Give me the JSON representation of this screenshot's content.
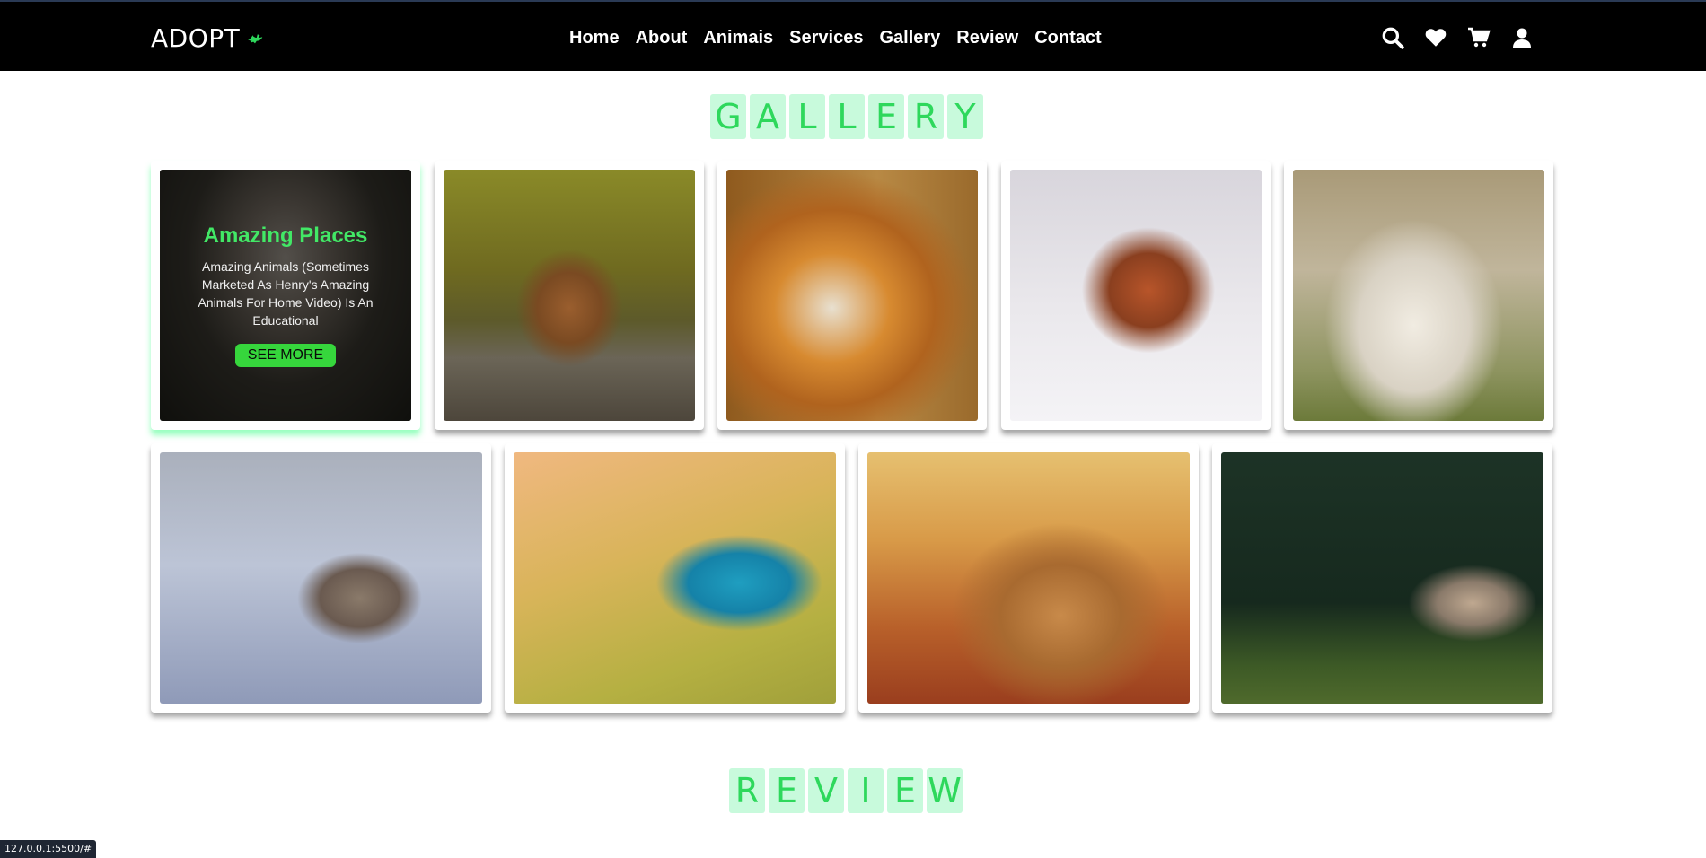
{
  "header": {
    "logo_text": "ADOPT",
    "logo_icon": "dove-icon",
    "nav": [
      "Home",
      "About",
      "Animais",
      "Services",
      "Gallery",
      "Review",
      "Contact"
    ],
    "icons": [
      "search-icon",
      "heart-icon",
      "cart-icon",
      "user-icon"
    ]
  },
  "gallery": {
    "title_letters": [
      "G",
      "A",
      "L",
      "L",
      "E",
      "R",
      "Y"
    ],
    "featured": {
      "title": "Amazing Places",
      "text": "Amazing Animals (Sometimes Marketed As Henry's Amazing Animals For Home Video) Is An Educational",
      "button": "SEE MORE"
    },
    "images": [
      "tiger-photo",
      "sleeping-fox-photo",
      "fox-portrait-photo",
      "fox-in-snow-photo",
      "sheep-photo",
      "jay-bird-photo",
      "kingfisher-photo",
      "lions-photo",
      "deer-photo"
    ]
  },
  "review": {
    "title_letters": [
      "R",
      "E",
      "V",
      "I",
      "E",
      "W"
    ]
  },
  "status_bar": {
    "url": "127.0.0.1:5500/#"
  },
  "colors": {
    "accent": "#2ed85c",
    "title_bg": "#c8fadc",
    "header_bg": "#000000"
  }
}
